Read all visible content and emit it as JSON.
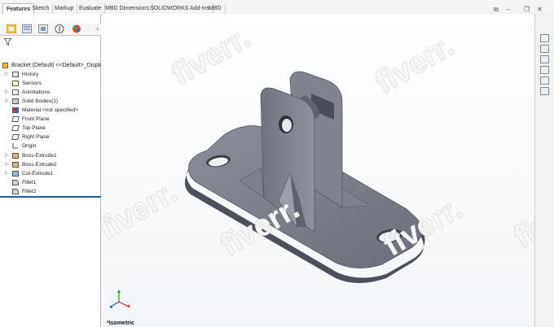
{
  "tabs": [
    {
      "label": "Features",
      "active": true
    },
    {
      "label": "Sketch",
      "active": false
    },
    {
      "label": "Markup",
      "active": false
    },
    {
      "label": "Evaluate",
      "active": false
    },
    {
      "label": "MBD Dimensions",
      "active": false
    },
    {
      "label": "SOLIDWORKS Add-Ins",
      "active": false
    },
    {
      "label": "MBD",
      "active": false
    }
  ],
  "feature_manager": {
    "root_label": "Bracket  (Default) <<Default>_Display",
    "items": [
      {
        "label": "History",
        "icon": "history-icon",
        "expandable": true
      },
      {
        "label": "Sensors",
        "icon": "sensor-icon",
        "expandable": false
      },
      {
        "label": "Annotations",
        "icon": "annotation-icon",
        "expandable": true
      },
      {
        "label": "Solid Bodies(1)",
        "icon": "solid-body-icon",
        "expandable": true
      },
      {
        "label": "Material <not specified>",
        "icon": "material-icon",
        "expandable": false
      },
      {
        "label": "Front Plane",
        "icon": "plane-icon",
        "expandable": false
      },
      {
        "label": "Top Plane",
        "icon": "plane-icon",
        "expandable": false
      },
      {
        "label": "Right Plane",
        "icon": "plane-icon",
        "expandable": false
      },
      {
        "label": "Origin",
        "icon": "origin-icon",
        "expandable": false
      },
      {
        "label": "Boss-Extrude1",
        "icon": "extrude-icon",
        "expandable": true
      },
      {
        "label": "Boss-Extrude2",
        "icon": "extrude-icon",
        "expandable": true
      },
      {
        "label": "Cut-Extrude1",
        "icon": "cut-extrude-icon",
        "expandable": true
      },
      {
        "label": "Fillet1",
        "icon": "fillet-icon",
        "expandable": false
      },
      {
        "label": "Fillet2",
        "icon": "fillet-icon",
        "expandable": false
      }
    ]
  },
  "viewport": {
    "view_label": "*Isometric",
    "watermark": "fiverr.",
    "model_color": "#6f7480"
  }
}
